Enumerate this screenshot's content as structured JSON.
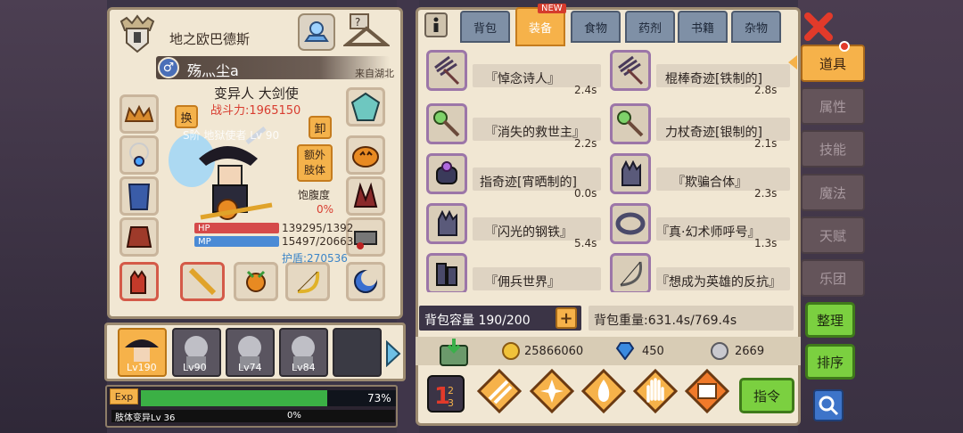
{
  "player": {
    "guild": "地之欧巴德斯",
    "name": "殇灬尘a",
    "gender_symbol": "♂",
    "origin": "来自湖北",
    "class": "变异人 大剑使",
    "power": "战斗力:1965150",
    "title": "S阶 地狱使者 Lv 90",
    "swap_label": "换",
    "unequip_label": "卸",
    "extra_limb_label": [
      "额外",
      "肢体"
    ],
    "hunger_label": "饱腹度",
    "hunger_value": "0%",
    "hp_label": "HP",
    "hp_value": "139295/1392",
    "mp_label": "MP",
    "mp_value": "15497/20663",
    "shield": "护盾:270536"
  },
  "party": [
    {
      "level": "Lv190",
      "selected": true
    },
    {
      "level": "Lv90",
      "selected": false
    },
    {
      "level": "Lv74",
      "selected": false
    },
    {
      "level": "Lv84",
      "selected": false
    },
    {
      "level": "",
      "selected": false
    }
  ],
  "exp": {
    "tag": "Exp",
    "percent": 73,
    "percent_text": "73%",
    "limb_label": "肢体变异Lv 36",
    "limb_percent_text": "0%"
  },
  "tabs": [
    {
      "label": "背包",
      "active": false
    },
    {
      "label": "装备",
      "active": true,
      "badge": "NEW"
    },
    {
      "label": "食物",
      "active": false
    },
    {
      "label": "药剂",
      "active": false
    },
    {
      "label": "书籍",
      "active": false
    },
    {
      "label": "杂物",
      "active": false
    }
  ],
  "items": [
    {
      "name": "『悼念诗人』",
      "weight": "2.4s",
      "icon": "rake-icon"
    },
    {
      "name": "棍棒奇迹[铁制的]",
      "weight": "2.8s",
      "icon": "rake-icon"
    },
    {
      "name": "『消失的救世主』",
      "weight": "2.2s",
      "icon": "staff-icon"
    },
    {
      "name": "力杖奇迹[银制的]",
      "weight": "2.1s",
      "icon": "staff-icon"
    },
    {
      "name": "指奇迹[宵晒制的]",
      "weight": "0.0s",
      "icon": "ring-icon"
    },
    {
      "name": "『欺骗合体』",
      "weight": "2.3s",
      "icon": "gauntlet-icon"
    },
    {
      "name": "『闪光的钢铁』",
      "weight": "5.4s",
      "icon": "gauntlet-icon"
    },
    {
      "name": "『真·幻术师呼号』",
      "weight": "1.3s",
      "icon": "collar-icon"
    },
    {
      "name": "『佣兵世界』",
      "weight": "",
      "icon": "armor-icon"
    },
    {
      "name": "『想成为英雄的反抗』",
      "weight": "",
      "icon": "bow-icon"
    }
  ],
  "bag": {
    "capacity": "背包容量 190/200",
    "weight": "背包重量:631.4s/769.4s"
  },
  "currency": {
    "gold": "25866060",
    "diamond": "450",
    "silver": "2669"
  },
  "actions": {
    "command_label": "指令"
  },
  "side_tabs": [
    {
      "label": "道具",
      "active": true
    },
    {
      "label": "属性",
      "active": false
    },
    {
      "label": "技能",
      "active": false
    },
    {
      "label": "魔法",
      "active": false
    },
    {
      "label": "天赋",
      "active": false
    },
    {
      "label": "乐团",
      "active": false
    }
  ],
  "side_buttons": {
    "organize": "整理",
    "sort": "排序"
  },
  "colors": {
    "accent": "#f6b24a",
    "panel": "#f1e7d3",
    "green": "#7bd040",
    "red": "#e23a2a"
  }
}
